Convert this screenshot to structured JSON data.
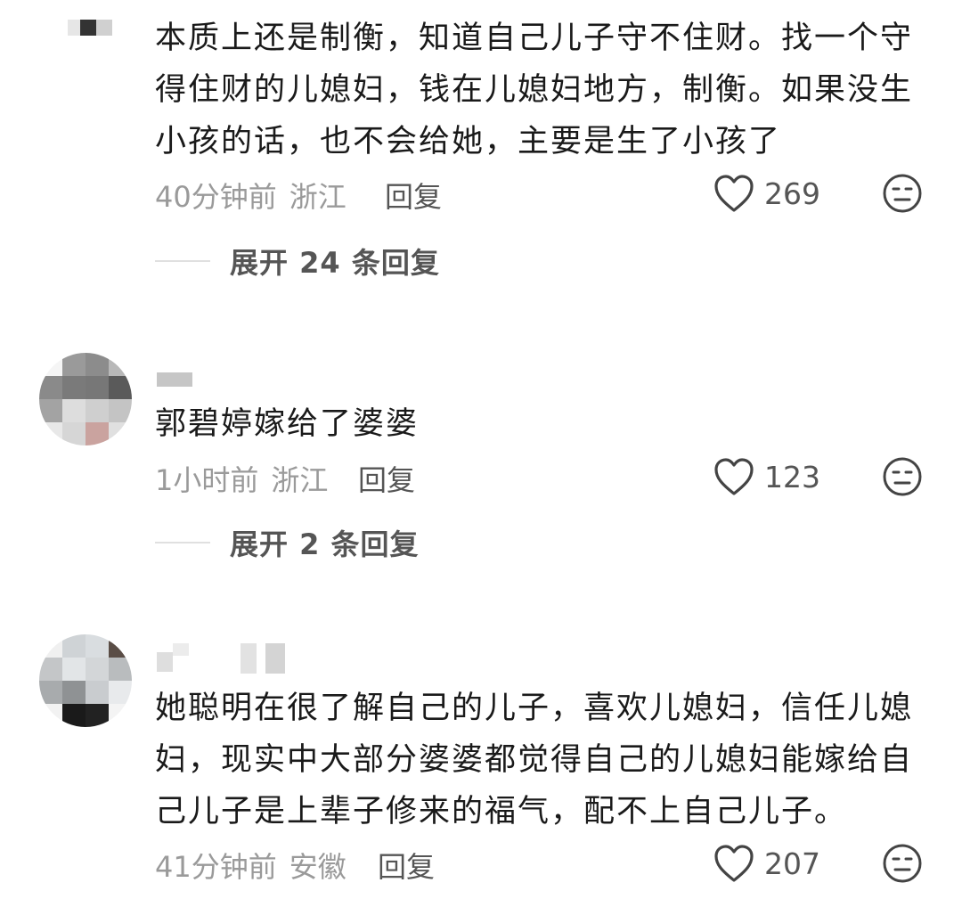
{
  "comments": [
    {
      "text": "本质上还是制衡，知道自己儿子守不住财。找一个守得住财的儿媳妇，钱在儿媳妇地方，制衡。如果没生小孩的话，也不会给她，主要是生了小孩了",
      "time": "40分钟前",
      "location": "浙江",
      "reply_label": "回复",
      "likes": "269",
      "expand_label": "展开 24 条回复"
    },
    {
      "text": "郭碧婷嫁给了婆婆",
      "time": "1小时前",
      "location": "浙江",
      "reply_label": "回复",
      "likes": "123",
      "expand_label": "展开 2 条回复"
    },
    {
      "text": "她聪明在很了解自己的儿子，喜欢儿媳妇，信任儿媳妇，现实中大部分婆婆都觉得自己的儿媳妇能嫁给自己儿子是上辈子修来的福气，配不上自己儿子。",
      "time": "41分钟前",
      "location": "安徽",
      "reply_label": "回复",
      "likes": "207"
    }
  ],
  "icons": {
    "like": "heart-outline-icon",
    "dislike": "neutral-face-icon"
  },
  "colors": {
    "text": "#1a1a1a",
    "meta": "#9a9a9a",
    "action": "#555555"
  }
}
